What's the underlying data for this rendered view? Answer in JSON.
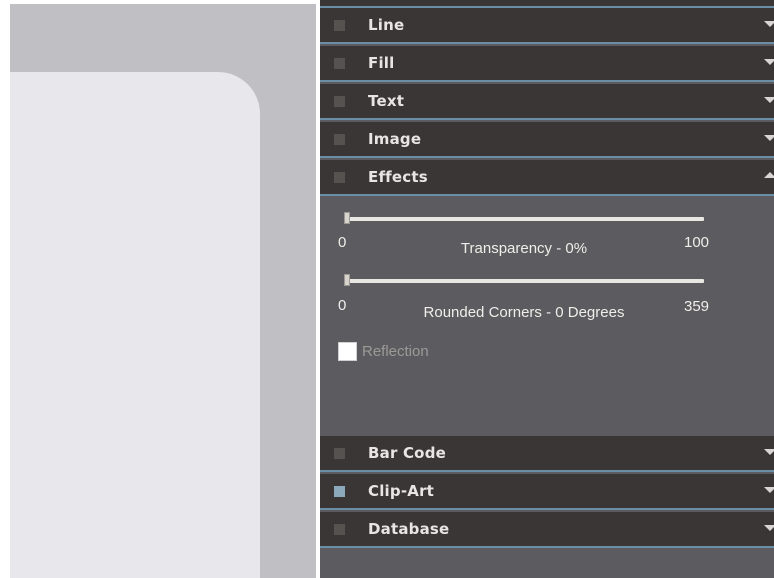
{
  "panel": {
    "sections": [
      {
        "id": "line",
        "label": "Line",
        "expanded": false
      },
      {
        "id": "fill",
        "label": "Fill",
        "expanded": false
      },
      {
        "id": "text",
        "label": "Text",
        "expanded": false
      },
      {
        "id": "image",
        "label": "Image",
        "expanded": false
      },
      {
        "id": "effects",
        "label": "Effects",
        "expanded": true
      },
      {
        "id": "barcode",
        "label": "Bar Code",
        "expanded": false
      },
      {
        "id": "clipart",
        "label": "Clip-Art",
        "expanded": false
      },
      {
        "id": "database",
        "label": "Database",
        "expanded": false
      }
    ]
  },
  "effects": {
    "transparency": {
      "min": "0",
      "max": "100",
      "value": 0,
      "label": "Transparency - 0%"
    },
    "rounded_corners": {
      "min": "0",
      "max": "359",
      "value": 0,
      "label": "Rounded Corners - 0 Degrees"
    },
    "reflection": {
      "label": "Reflection",
      "checked": false
    }
  },
  "colors": {
    "panel_bg": "#5c5b5f",
    "header_bg": "#3a3635",
    "header_rule": "#6a8ea5",
    "canvas_bg": "#c0c0c4",
    "card_bg": "#e8e7ec"
  }
}
